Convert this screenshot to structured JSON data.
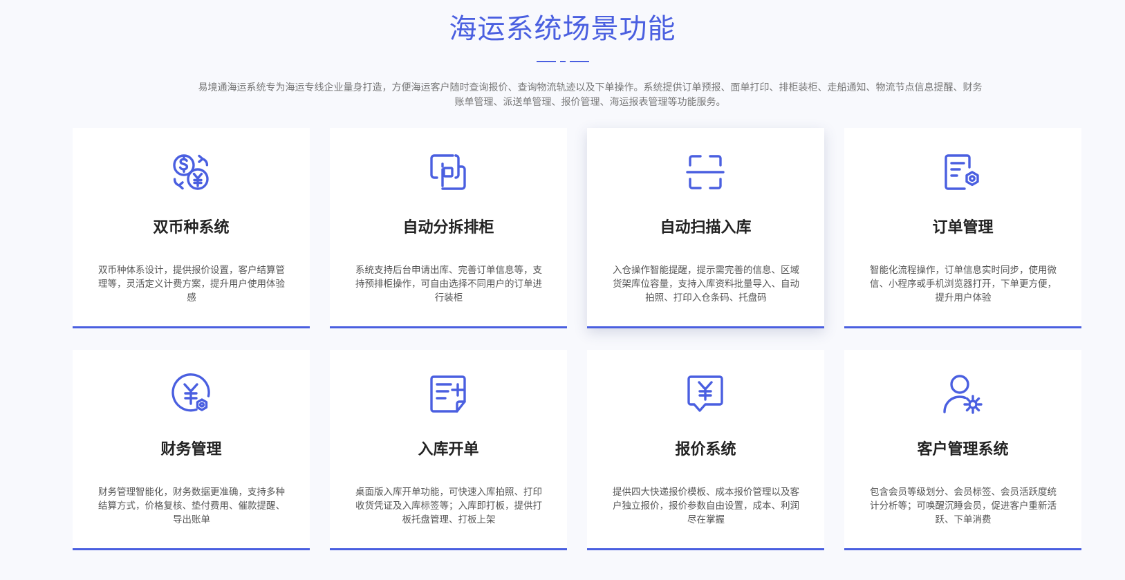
{
  "header": {
    "title": "海运系统场景功能",
    "description": "易境通海运系统专为海运专线企业量身打造，方便海运客户随时查询报价、查询物流轨迹以及下单操作。系统提供订单预报、面单打印、排柜装柜、走船通知、物流节点信息提醒、财务账单管理、派送单管理、报价管理、海运报表管理等功能服务。"
  },
  "accent_color": "#4a5fe0",
  "features": [
    {
      "icon": "currency-exchange-icon",
      "title": "双币种系统",
      "text": "双币种体系设计，提供报价设置，客户结算管理等，灵活定义计费方案，提升用户使用体验感"
    },
    {
      "icon": "split-boxes-icon",
      "title": "自动分拆排柜",
      "text": "系统支持后台申请出库、完善订单信息等，支持预排柜操作，可自由选择不同用户的订单进行装柜"
    },
    {
      "icon": "scan-icon",
      "title": "自动扫描入库",
      "text": "入仓操作智能提醒，提示需完善的信息、区域货架库位容量，支持入库资料批量导入、自动拍照、打印入仓条码、托盘码"
    },
    {
      "icon": "order-settings-icon",
      "title": "订单管理",
      "text": "智能化流程操作，订单信息实时同步，使用微信、小程序或手机浏览器打开，下单更方便，提升用户体验"
    },
    {
      "icon": "finance-yen-icon",
      "title": "财务管理",
      "text": "财务管理智能化，财务数据更准确，支持多种结算方式，价格复核、垫付费用、催款提醒、导出账单"
    },
    {
      "icon": "document-add-icon",
      "title": "入库开单",
      "text": "桌面版入库开单功能，可快速入库拍照、打印收货凭证及入库标签等；入库即打板，提供打板托盘管理、打板上架"
    },
    {
      "icon": "quote-message-icon",
      "title": "报价系统",
      "text": "提供四大快递报价模板、成本报价管理以及客户独立报价，报价参数自由设置，成本、利润尽在掌握"
    },
    {
      "icon": "user-settings-icon",
      "title": "客户管理系统",
      "text": "包含会员等级划分、会员标签、会员活跃度统计分析等；可唤醒沉睡会员，促进客户重新活跃、下单消费"
    }
  ]
}
